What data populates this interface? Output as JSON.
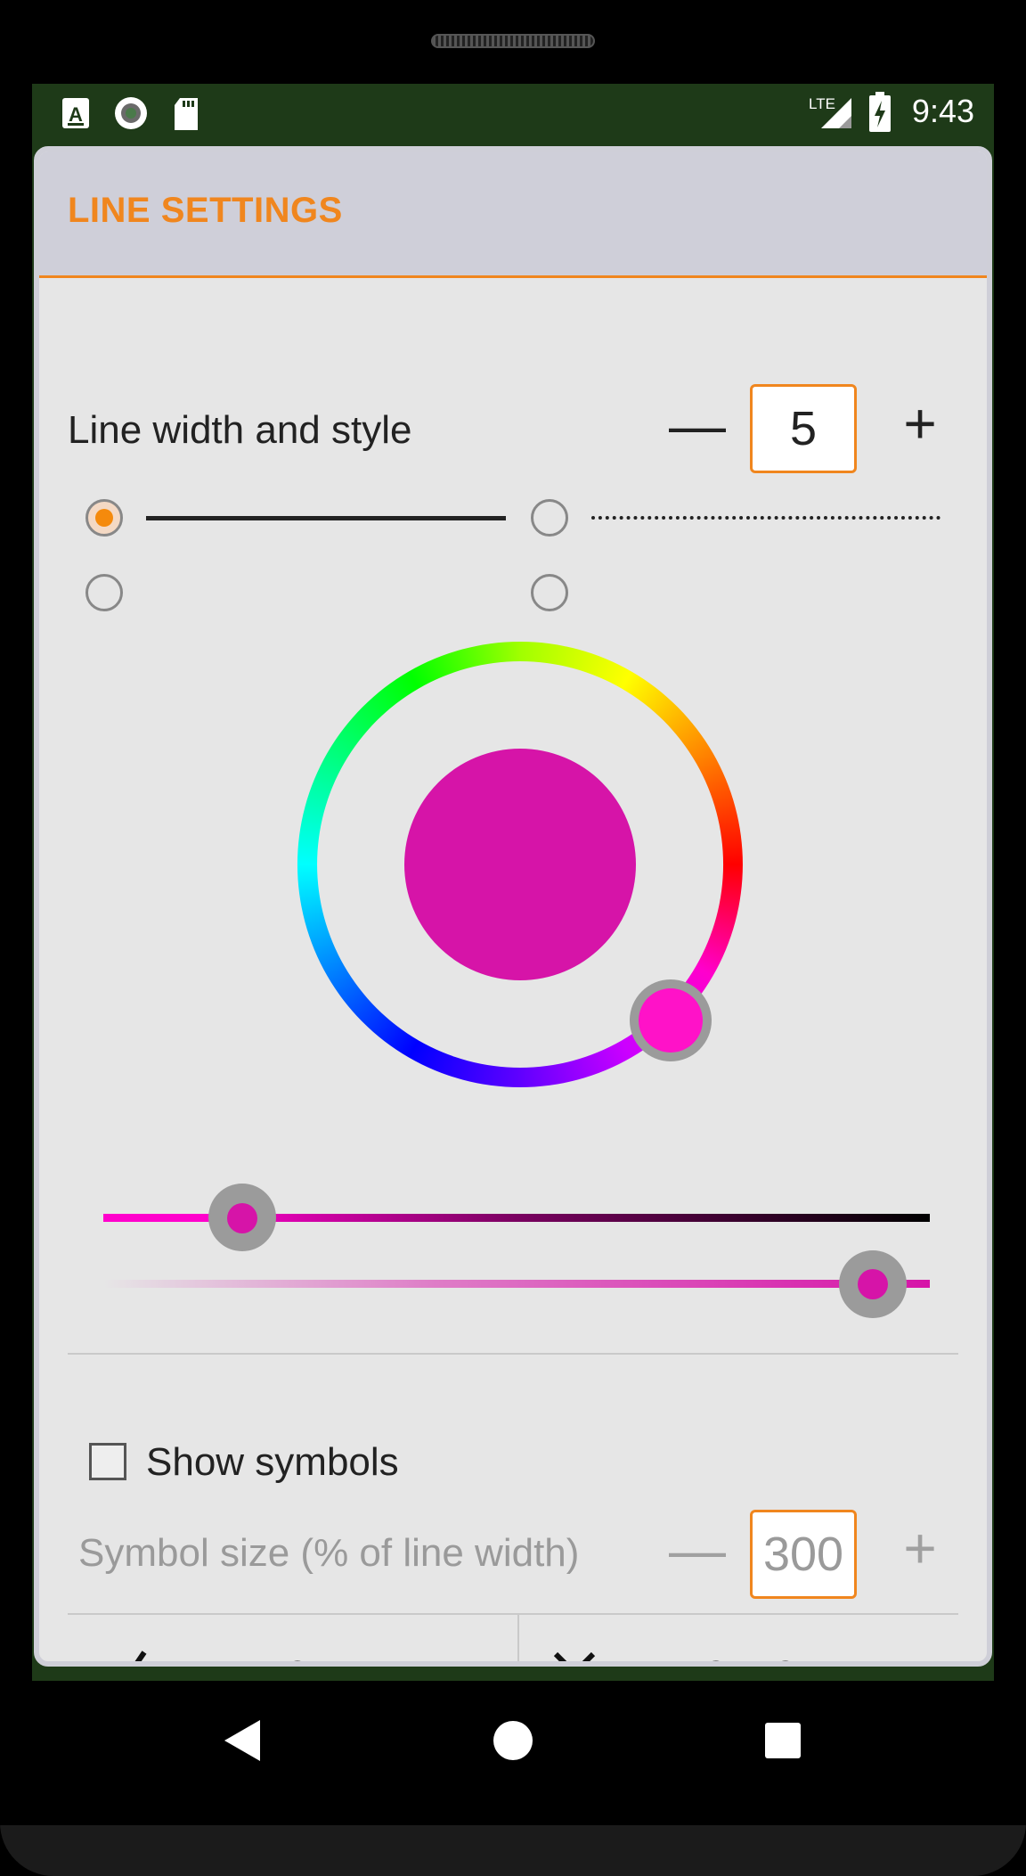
{
  "status_bar": {
    "time": "9:43",
    "icons": [
      "a-notification-icon",
      "record-icon",
      "sd-card-icon",
      "lte-signal-icon",
      "battery-charging-icon"
    ],
    "network_label": "LTE"
  },
  "dialog": {
    "title": "LINE SETTINGS",
    "line_width": {
      "label": "Line width and style",
      "value": "5",
      "minus": "—",
      "plus": "+"
    },
    "line_styles": [
      {
        "style": "solid",
        "selected": true
      },
      {
        "style": "dotted",
        "selected": false
      },
      {
        "style": "dashed",
        "selected": false
      },
      {
        "style": "dash-dot",
        "selected": false
      }
    ],
    "color_picker": {
      "selected_color": "#d614a8",
      "hue_handle_color": "#ff12c8",
      "shade_slider_position": 0.16,
      "opacity_slider_position": 0.92
    },
    "show_symbols": {
      "label": "Show symbols",
      "checked": false
    },
    "symbol_size": {
      "label": "Symbol size (% of line width)",
      "value": "300",
      "minus": "—",
      "plus": "+"
    },
    "buttons": {
      "ok": "OK",
      "cancel": "CANCEL"
    }
  },
  "colors": {
    "accent": "#f0861e",
    "header_bg": "#cfcfd9",
    "dialog_bg": "#e6e6e6",
    "status_bg": "#1e3a18"
  }
}
